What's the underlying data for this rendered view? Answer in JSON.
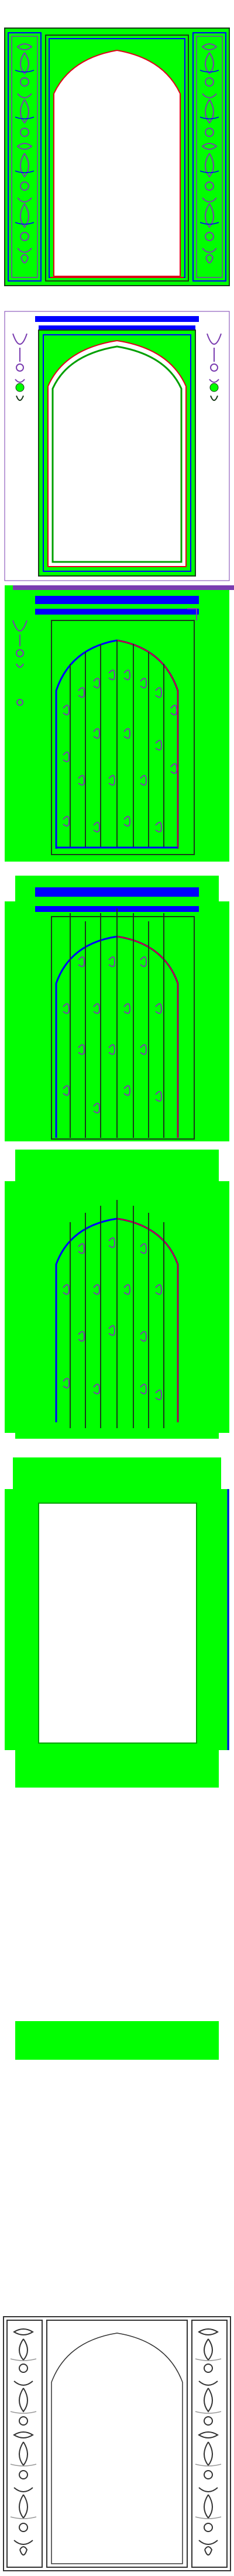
{
  "colors": {
    "background": "#ffffff",
    "panel_green": "#00ff00",
    "frame_blue": "#0000ff",
    "frame_purple": "#7a3cb0",
    "frame_red": "#e0001a",
    "frame_dark": "#1a3a1a",
    "ornament_dark": "#333333",
    "ornament_light": "#999999"
  },
  "elements": {
    "1": {
      "name": "ornate-archway-frame-green",
      "fill": "panel_green"
    },
    "2": {
      "name": "archway-frame-outline-with-side-ornaments",
      "fill": "background"
    },
    "3": {
      "name": "arched-grille-door-with-scrolls",
      "fill": "panel_green"
    },
    "4": {
      "name": "arched-grille-door-variant",
      "fill": "panel_green"
    },
    "5": {
      "name": "arched-grille-door-plain",
      "fill": "panel_green"
    },
    "6": {
      "name": "rectangular-opening-frame",
      "fill": "panel_green"
    },
    "7": {
      "name": "flat-green-panel",
      "fill": "panel_green"
    },
    "8": {
      "name": "ornate-archway-frame-monochrome",
      "fill": "background"
    }
  }
}
